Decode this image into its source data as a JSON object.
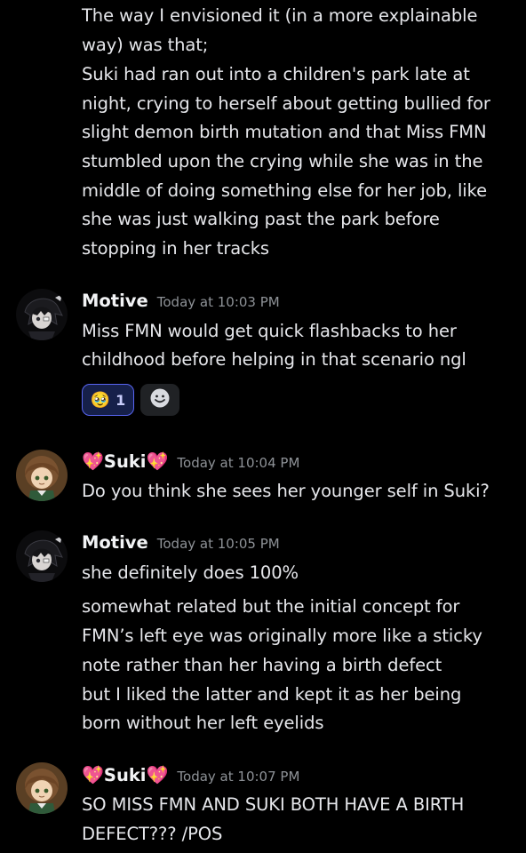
{
  "messages": [
    {
      "continuation_lines": [
        "The way I envisioned it (in a more explainable",
        "way) was that;",
        "Suki had ran out into a children's park late at",
        "night, crying to herself about getting bullied for",
        "slight demon birth mutation and that Miss FMN",
        "stumbled upon the crying while she was in the",
        "middle of doing something else for her job, like",
        "she was just walking past the park before",
        "stopping in her tracks"
      ]
    },
    {
      "author": "Motive",
      "timestamp": "Today at 10:03 PM",
      "lines": [
        "Miss FMN would get quick flashbacks to her",
        "childhood before helping in that scenario ngl"
      ],
      "reaction": {
        "emoji": "🥹",
        "count": "1",
        "add_icon": "☻"
      }
    },
    {
      "author": "Suki",
      "author_decoration": "💖",
      "timestamp": "Today at 10:04 PM",
      "lines": [
        "Do you think she sees her younger self in Suki?"
      ]
    },
    {
      "author": "Motive",
      "timestamp": "Today at 10:05 PM",
      "lines": [
        "she definitely does 100%",
        "somewhat related but the initial concept for",
        "FMN’s left eye was originally more like a sticky",
        "note rather than her having a birth defect",
        "but I liked the latter and kept it as her being",
        "born without her left eyelids"
      ]
    },
    {
      "author": "Suki",
      "author_decoration": "💖",
      "timestamp": "Today at 10:07 PM",
      "lines": [
        "SO MISS FMN AND SUKI BOTH HAVE A BIRTH",
        "DEFECT??? /POS"
      ]
    }
  ],
  "colors": {
    "background": "#000000",
    "text": "#e6e7eb",
    "timestamp": "#8e9297",
    "reaction_active_border": "#5865f2",
    "heart": "#ff6fa8"
  }
}
